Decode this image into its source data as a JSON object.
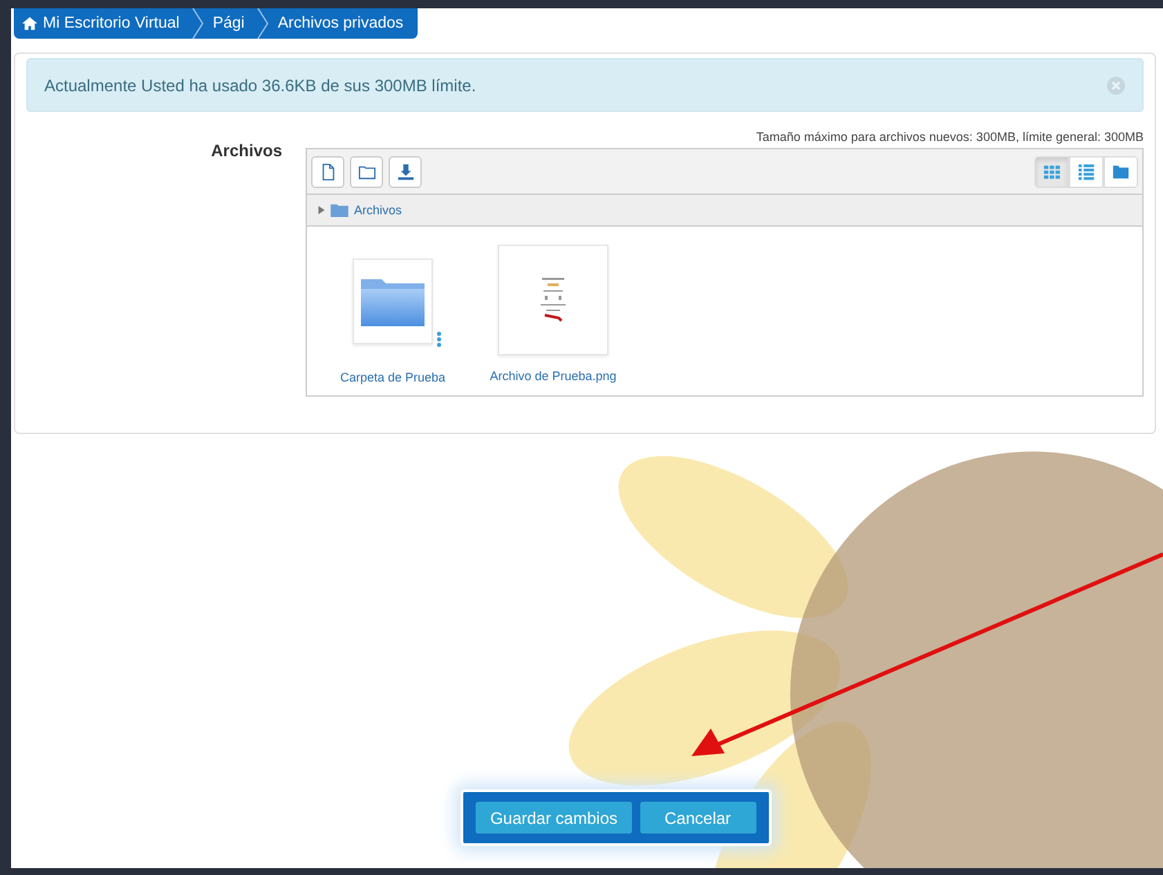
{
  "breadcrumb": [
    {
      "label": "Mi Escritorio Virtual",
      "kind": "home"
    },
    {
      "label": "Pági",
      "kind": "link"
    },
    {
      "label": "Archivos privados",
      "kind": "link"
    }
  ],
  "alert": {
    "text": "Actualmente Usted ha usado 36.6KB de sus 300MB límite."
  },
  "files_field": {
    "label": "Archivos",
    "note": "Tamaño máximo para archivos nuevos: 300MB, límite general: 300MB",
    "toolbar": [
      {
        "kind": "file"
      },
      {
        "kind": "folder"
      },
      {
        "kind": "download"
      }
    ],
    "views": [
      {
        "kind": "grid",
        "selected": true
      },
      {
        "kind": "list",
        "selected": false
      },
      {
        "kind": "tree",
        "selected": false
      }
    ],
    "path": "Archivos",
    "items": [
      {
        "kind": "folder",
        "name": "Carpeta de Prueba"
      },
      {
        "kind": "image",
        "name": "Archivo de Prueba.png"
      }
    ]
  },
  "buttons": [
    {
      "label": "Guardar cambios"
    },
    {
      "label": "Cancelar"
    }
  ]
}
